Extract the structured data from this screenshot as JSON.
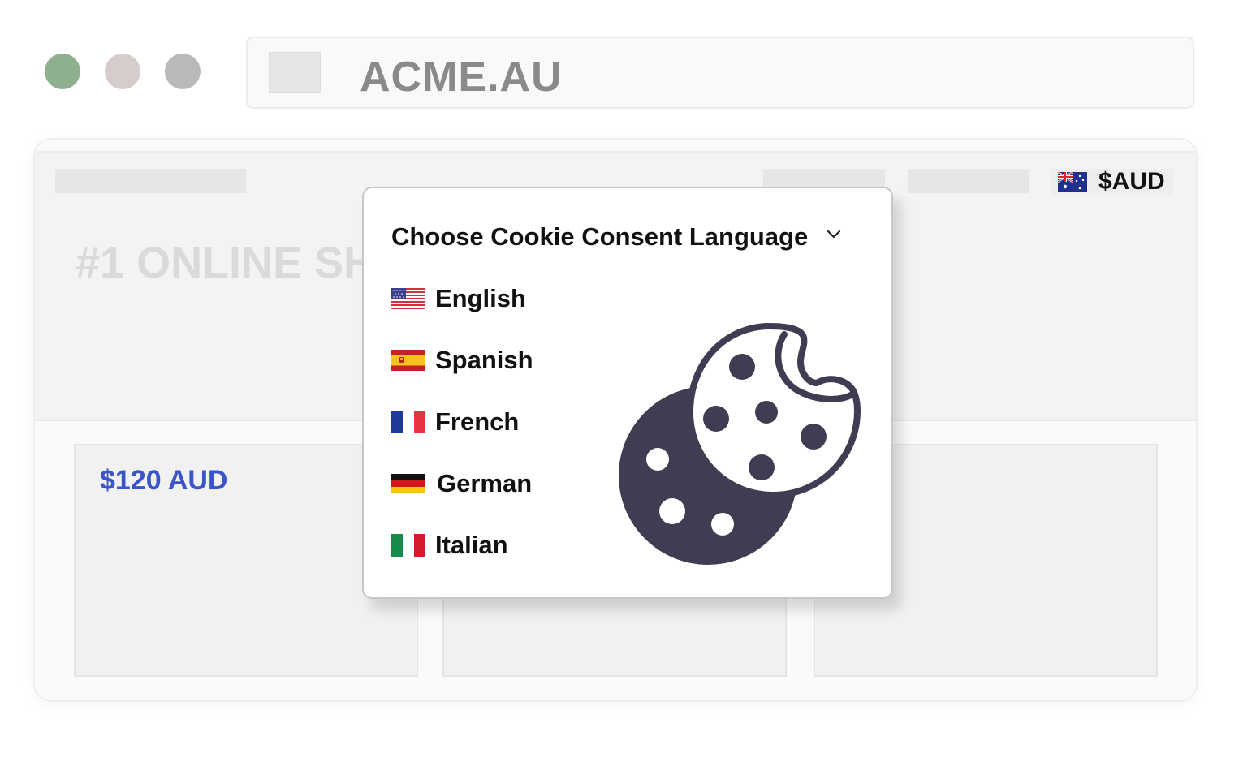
{
  "browser": {
    "window_controls": [
      {
        "name": "close",
        "color": "#8fb08f"
      },
      {
        "name": "minimize",
        "color": "#d6cccc"
      },
      {
        "name": "maximize",
        "color": "#b9b9b9"
      }
    ],
    "address": "ACME.AU"
  },
  "page": {
    "currency_selector": {
      "flag": "australia-flag-icon",
      "label": "$AUD"
    },
    "hero_title": "#1 ONLINE SH",
    "products": [
      {
        "price": "$120 AUD"
      },
      {
        "price": ""
      },
      {
        "price": ""
      }
    ]
  },
  "cookie_popup": {
    "title": "Choose Cookie Consent Language",
    "dropdown_icon": "chevron-down-icon",
    "illustration": "cookie-icon",
    "languages": [
      {
        "label": "English",
        "flag": "us-flag-icon"
      },
      {
        "label": "Spanish",
        "flag": "spain-flag-icon"
      },
      {
        "label": "French",
        "flag": "france-flag-icon"
      },
      {
        "label": "German",
        "flag": "germany-flag-icon"
      },
      {
        "label": "Italian",
        "flag": "italy-flag-icon"
      }
    ]
  },
  "colors": {
    "price": "#3a54c9",
    "cookie": "#403d52",
    "dot_green": "#8fb08f",
    "dot_pink": "#d6cccc",
    "dot_grey": "#b9b9b9"
  }
}
